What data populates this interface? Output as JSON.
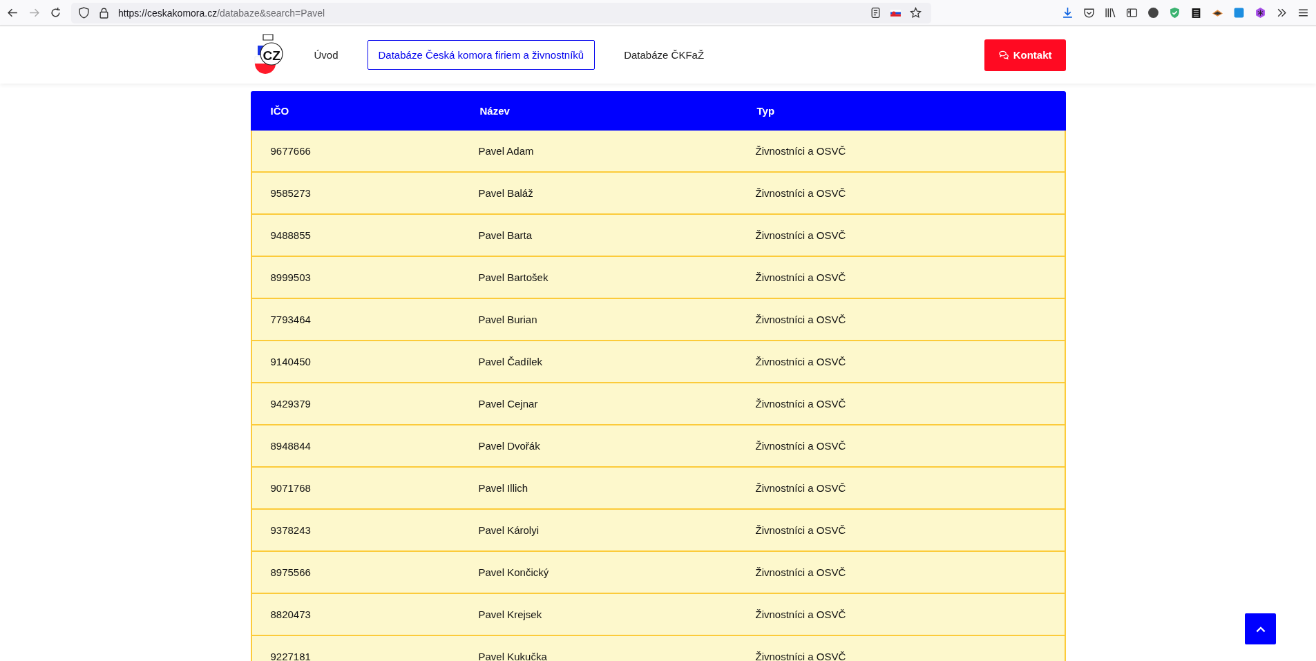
{
  "browser": {
    "url_host": "https://ceskakomora.cz",
    "url_path": "/databaze&search=Pavel"
  },
  "nav": {
    "items": [
      {
        "label": "Úvod",
        "selected": false
      },
      {
        "label": "Databáze Česká komora firiem a živnostníků",
        "selected": true
      },
      {
        "label": "Databáze ČKFaŽ",
        "selected": false
      }
    ],
    "logo": "CZ",
    "contact": "Kontakt"
  },
  "table": {
    "columns": [
      "IČO",
      "Název",
      "Typ"
    ],
    "rows": [
      [
        "9677666",
        "Pavel Adam",
        "Živnostníci a OSVČ"
      ],
      [
        "9585273",
        "Pavel Baláž",
        "Živnostníci a OSVČ"
      ],
      [
        "9488855",
        "Pavel Barta",
        "Živnostníci a OSVČ"
      ],
      [
        "8999503",
        "Pavel Bartošek",
        "Živnostníci a OSVČ"
      ],
      [
        "7793464",
        "Pavel Burian",
        "Živnostníci a OSVČ"
      ],
      [
        "9140450",
        "Pavel Čadílek",
        "Živnostníci a OSVČ"
      ],
      [
        "9429379",
        "Pavel Cejnar",
        "Živnostníci a OSVČ"
      ],
      [
        "8948844",
        "Pavel Dvořák",
        "Živnostníci a OSVČ"
      ],
      [
        "9071768",
        "Pavel Illich",
        "Živnostníci a OSVČ"
      ],
      [
        "9378243",
        "Pavel Károlyi",
        "Živnostníci a OSVČ"
      ],
      [
        "8975566",
        "Pavel Končický",
        "Živnostníci a OSVČ"
      ],
      [
        "8820473",
        "Pavel Krejsek",
        "Živnostníci a OSVČ"
      ],
      [
        "9227181",
        "Pavel Kukučka",
        "Živnostníci a OSVČ"
      ]
    ]
  }
}
